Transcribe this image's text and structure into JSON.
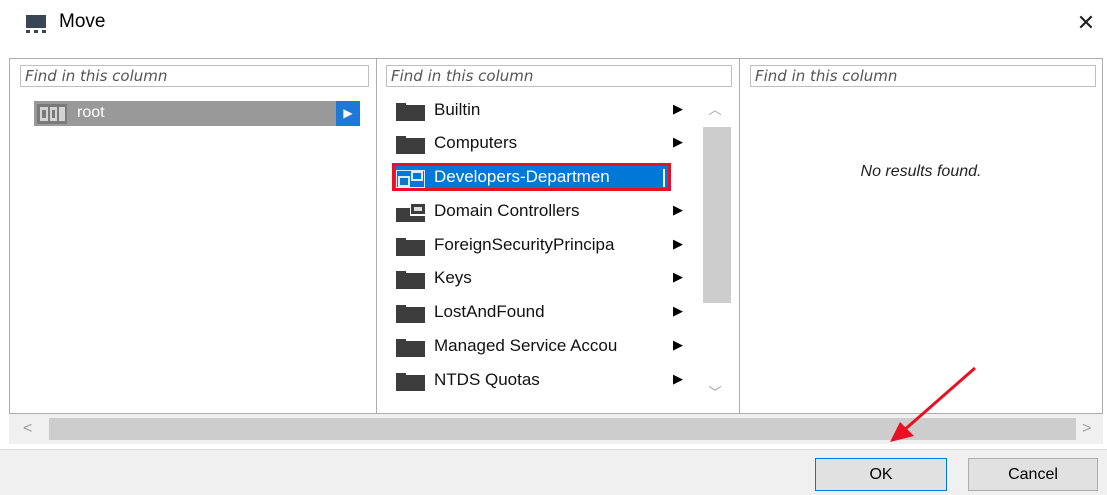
{
  "window": {
    "title": "Move",
    "close_icon": "close-icon"
  },
  "colors": {
    "accent": "#0078d7",
    "highlight_outline": "#e81123",
    "root_bg": "#999999",
    "root_arrow_bg": "#1e78d7"
  },
  "columns": [
    {
      "search_placeholder": "Find in this column",
      "items": [
        {
          "label": "root",
          "icon": "domain-root-icon",
          "selected": true,
          "has_children": true
        }
      ]
    },
    {
      "search_placeholder": "Find in this column",
      "items": [
        {
          "label": "Builtin",
          "icon": "folder-icon",
          "has_children": true
        },
        {
          "label": "Computers",
          "icon": "folder-icon",
          "has_children": true
        },
        {
          "label": "Developers-Departmen",
          "icon": "organizational-unit-icon",
          "selected": true,
          "editing": true,
          "has_children": false
        },
        {
          "label": "Domain Controllers",
          "icon": "organizational-unit-icon",
          "has_children": true
        },
        {
          "label": "ForeignSecurityPrincipa",
          "icon": "folder-icon",
          "has_children": true
        },
        {
          "label": "Keys",
          "icon": "folder-icon",
          "has_children": true
        },
        {
          "label": "LostAndFound",
          "icon": "folder-icon",
          "has_children": true
        },
        {
          "label": "Managed Service Accou",
          "icon": "folder-icon",
          "has_children": true
        },
        {
          "label": "NTDS Quotas",
          "icon": "folder-icon",
          "has_children": true
        }
      ]
    },
    {
      "search_placeholder": "Find in this column",
      "empty_message": "No results found."
    }
  ],
  "footer": {
    "ok_label": "OK",
    "cancel_label": "Cancel"
  }
}
